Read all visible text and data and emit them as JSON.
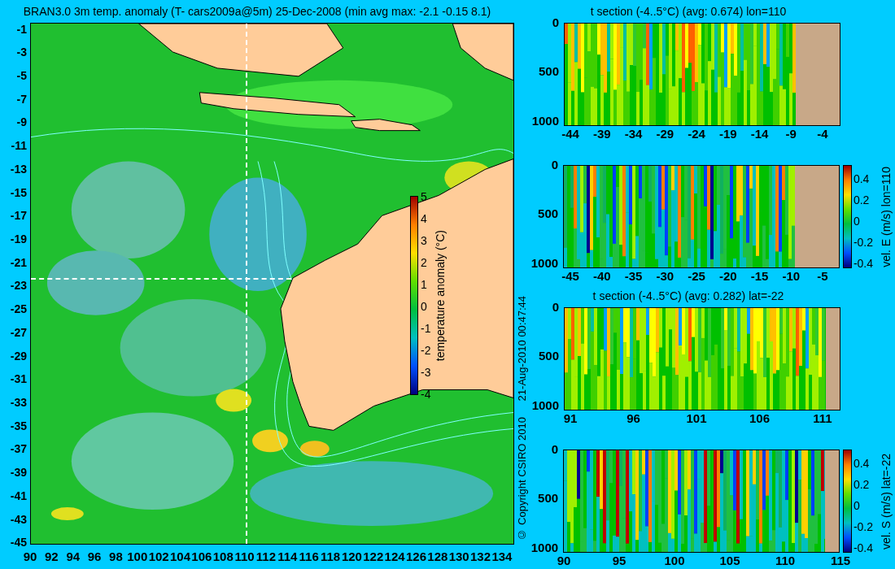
{
  "map": {
    "title": "BRAN3.0 3m temp. anomaly (T- cars2009a@5m) 25-Dec-2008 (min avg max: -2.1 -0.15 8.1)",
    "y_ticks": [
      "-1",
      "-3",
      "-5",
      "-7",
      "-9",
      "-11",
      "-13",
      "-15",
      "-17",
      "-19",
      "-21",
      "-23",
      "-25",
      "-27",
      "-29",
      "-31",
      "-33",
      "-35",
      "-37",
      "-39",
      "-41",
      "-43",
      "-45"
    ],
    "x_ticks": [
      "90",
      "92",
      "94",
      "96",
      "98",
      "100",
      "102",
      "104",
      "106",
      "108",
      "110",
      "112",
      "114",
      "116",
      "118",
      "120",
      "122",
      "124",
      "126",
      "128",
      "130",
      "132",
      "134"
    ],
    "colorbar": {
      "label": "temperature anomaly (°C)",
      "ticks": [
        "5",
        "4",
        "3",
        "2",
        "1",
        "0",
        "-1",
        "-2",
        "-3",
        "-4"
      ]
    }
  },
  "credits": [
    "© Copyright CSIRO 2010",
    "21-Aug-2010 00:47:44"
  ],
  "sections": [
    {
      "kind": "temperature",
      "title": "t section (-4..5°C) (avg: 0.674) lon=110",
      "y_ticks": [
        "0",
        "500",
        "1000"
      ],
      "x_ticks": [
        "-44",
        "-39",
        "-34",
        "-29",
        "-24",
        "-19",
        "-14",
        "-9",
        "-4"
      ]
    },
    {
      "kind": "velocity",
      "y_ticks": [
        "0",
        "500",
        "1000"
      ],
      "x_ticks": [
        "-45",
        "-40",
        "-35",
        "-30",
        "-25",
        "-20",
        "-15",
        "-10",
        "-5"
      ],
      "colorbar": {
        "label": "vel. E (m/s) lon=110",
        "ticks": [
          "0.4",
          "0.2",
          "0",
          "-0.2",
          "-0.4"
        ]
      }
    },
    {
      "kind": "temperature",
      "title": "t section (-4..5°C) (avg: 0.282) lat=-22",
      "y_ticks": [
        "0",
        "500",
        "1000"
      ],
      "x_ticks": [
        "91",
        "96",
        "101",
        "106",
        "111"
      ]
    },
    {
      "kind": "velocity",
      "y_ticks": [
        "0",
        "500",
        "1000"
      ],
      "x_ticks": [
        "90",
        "95",
        "100",
        "105",
        "110",
        "115"
      ],
      "colorbar": {
        "label": "vel. S (m/s) lat=-22",
        "ticks": [
          "0.4",
          "0.2",
          "0",
          "-0.2",
          "-0.4"
        ]
      }
    }
  ]
}
